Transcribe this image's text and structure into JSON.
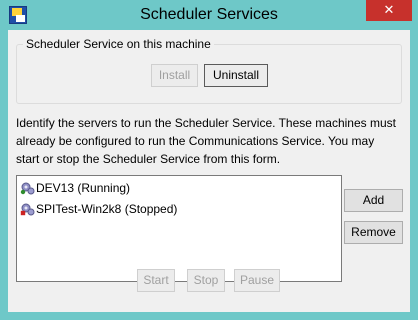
{
  "window": {
    "title": "Scheduler Services",
    "close_glyph": "✕",
    "app_icon": "scheduler-app-icon"
  },
  "local_group": {
    "legend": "Scheduler Service on this machine",
    "install_label": "Install",
    "uninstall_label": "Uninstall"
  },
  "description": {
    "line1": "Identify the servers to run the Scheduler Service. These machines must",
    "line2": "already be configured to run the Communications Service. You may",
    "line3": "start or stop the Scheduler Service from this form."
  },
  "servers": {
    "items": [
      {
        "label": "DEV13 (Running)",
        "icon": "gear-icon",
        "status_color": "#2e8b2e"
      },
      {
        "label": "SPITest-Win2k8 (Stopped)",
        "icon": "gear-icon",
        "status_color": "#cc2222"
      }
    ],
    "add_label": "Add",
    "remove_label": "Remove"
  },
  "controls": {
    "start_label": "Start",
    "stop_label": "Stop",
    "pause_label": "Pause"
  },
  "colors": {
    "frame": "#6ec8c8",
    "close": "#c7312c",
    "client": "#f0f0f0"
  }
}
